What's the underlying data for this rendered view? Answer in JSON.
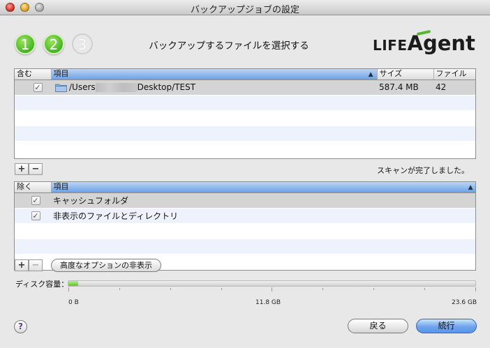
{
  "window": {
    "title": "バックアップジョブの設定"
  },
  "steps": [
    "1",
    "2",
    "3"
  ],
  "heading": "バックアップするファイルを選択する",
  "logo": {
    "part1": "LIFE",
    "part2": "Agent"
  },
  "include_table": {
    "columns": [
      "含む",
      "項目",
      "サイズ",
      "ファイル"
    ],
    "rows": [
      {
        "checked": true,
        "path_prefix": "/Users",
        "path_suffix": "Desktop/TEST",
        "size": "587.4 MB",
        "files": "42"
      }
    ]
  },
  "status_text": "スキャンが完了しました。",
  "exclude_table": {
    "columns": [
      "除く",
      "項目"
    ],
    "rows": [
      {
        "checked": true,
        "label": "キャッシュフォルダ"
      },
      {
        "checked": true,
        "label": "非表示のファイルとディレクトリ"
      }
    ]
  },
  "buttons": {
    "add": "+",
    "remove": "−",
    "advanced": "高度なオプションの非表示",
    "help": "?",
    "back": "戻る",
    "next": "続行"
  },
  "disk": {
    "label": "ディスク容量：",
    "used_fraction": 0.024,
    "ticks": [
      "0 B",
      "11.8 GB",
      "23.6 GB"
    ]
  },
  "colors": {
    "accent_green": "#54b82d",
    "selection_blue": "#6ba1e6"
  }
}
